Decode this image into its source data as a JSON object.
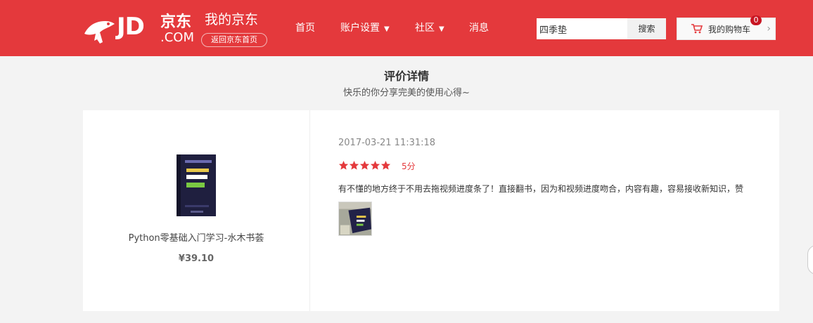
{
  "header": {
    "logo_text": "JD",
    "logo_cn": "京东",
    "logo_com": ".COM",
    "site_title": "我的京东",
    "back_home": "返回京东首页",
    "nav": [
      "首页",
      "账户设置",
      "社区",
      "消息"
    ],
    "search": {
      "value": "四季垫",
      "button": "搜索"
    },
    "cart": {
      "label": "我的购物车",
      "count": "0"
    }
  },
  "page": {
    "title": "评价详情",
    "subtitle": "快乐的你分享完美的使用心得~"
  },
  "product": {
    "name": "Python零基础入门学习-水木书荟",
    "price": "¥39.10"
  },
  "review": {
    "date": "2017-03-21 11:31:18",
    "rating": 5,
    "score_label": "5分",
    "text": "有不懂的地方终于不用去拖视频进度条了！直接翻书，因为和视频进度吻合，内容有趣，容易接收新知识，赞"
  },
  "colors": {
    "brand_red": "#e4393c",
    "badge_red": "#c81623"
  }
}
